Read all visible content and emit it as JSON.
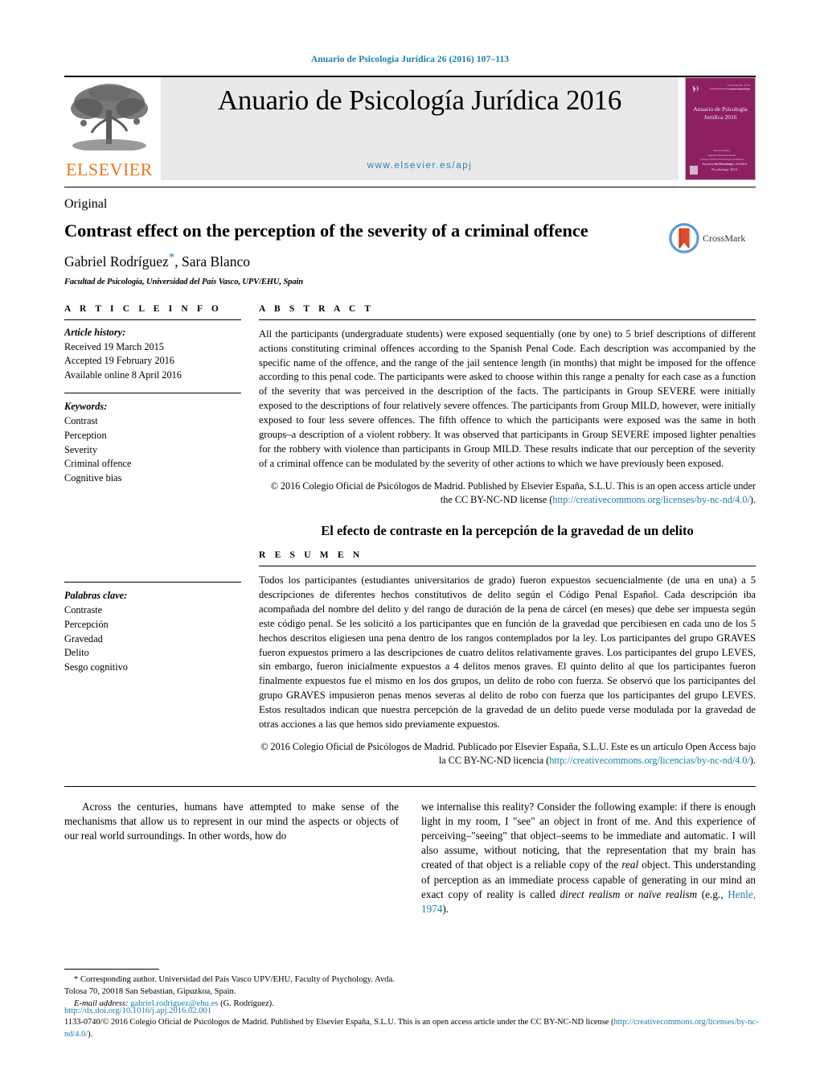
{
  "running_head": "Anuario de Psicología Jurídica 26 (2016) 107–113",
  "masthead": {
    "publisher_name": "ELSEVIER",
    "journal_title": "Anuario de Psicología Jurídica 2016",
    "journal_url": "www.elsevier.es/apj",
    "cover": {
      "issue_line1": "Volumen 26, 2016",
      "issue_line2": "ISSN 1133-0740",
      "title": "Anuario de Psicología Jurídica 2016",
      "mid_line1": "Director/Editor",
      "mid_line2": "Manuel Jiménez Redondo",
      "mid_line3": "Colegio Oficial de Psicólogos de Madrid",
      "mid_line4": "y Elsevier España",
      "bottom_line1": "Anuario de Psicología Jurídica",
      "bottom_line2": "Psychology 2016"
    }
  },
  "article": {
    "kind": "Original",
    "title": "Contrast effect on the perception of the severity of a criminal offence",
    "authors_part1": "Gabriel Rodríguez",
    "author_asterisk": "*",
    "authors_part2": ", Sara Blanco",
    "affiliation": "Facultad de Psicología, Universidad del País Vasco, UPV/EHU, Spain",
    "crossmark_label": "CrossMark"
  },
  "article_info": {
    "heading": "A R T I C L E   I N F O",
    "history_label": "Article history:",
    "received": "Received 19 March 2015",
    "accepted": "Accepted 19 February 2016",
    "available": "Available online 8 April 2016",
    "keywords_label": "Keywords:",
    "keywords": [
      "Contrast",
      "Perception",
      "Severity",
      "Criminal offence",
      "Cognitive bias"
    ],
    "palabras_label": "Palabras clave:",
    "palabras": [
      "Contraste",
      "Percepción",
      "Gravedad",
      "Delito",
      "Sesgo cognitivo"
    ]
  },
  "abstract": {
    "heading": "A B S T R A C T",
    "text": "All the participants (undergraduate students) were exposed sequentially (one by one) to 5 brief descriptions of different actions constituting criminal offences according to the Spanish Penal Code. Each description was accompanied by the specific name of the offence, and the range of the jail sentence length (in months) that might be imposed for the offence according to this penal code. The participants were asked to choose within this range a penalty for each case as a function of the severity that was perceived in the description of the facts. The participants in Group SEVERE were initially exposed to the descriptions of four relatively severe offences. The participants from Group MILD, however, were initially exposed to four less severe offences. The fifth offence to which the participants were exposed was the same in both groups–a description of a violent robbery. It was observed that participants in Group SEVERE imposed lighter penalties for the robbery with violence than participants in Group MILD. These results indicate that our perception of the severity of a criminal offence can be modulated by the severity of other actions to which we have previously been exposed.",
    "copyright_pre": "© 2016 Colegio Oficial de Psicólogos de Madrid. Published by Elsevier España, S.L.U. This is an open access article under the CC BY-NC-ND license (",
    "copyright_link": "http://creativecommons.org/licenses/by-nc-nd/4.0/",
    "copyright_post": ")."
  },
  "resumen": {
    "title_es": "El efecto de contraste en la percepción de la gravedad de un delito",
    "heading": "R E S U M E N",
    "text": "Todos los participantes (estudiantes universitarios de grado) fueron expuestos secuencialmente (de una en una) a 5 descripciones de diferentes hechos constitutivos de delito según el Código Penal Español. Cada descripción iba acompañada del nombre del delito y del rango de duración de la pena de cárcel (en meses) que debe ser impuesta según este código penal. Se les solicitó a los participantes que en función de la gravedad que percibiesen en cada uno de los 5 hechos descritos eligiesen una pena dentro de los rangos contemplados por la ley. Los participantes del grupo GRAVES fueron expuestos primero a las descripciones de cuatro delitos relativamente graves. Los participantes del grupo LEVES, sin embargo, fueron inicialmente expuestos a 4 delitos menos graves. El quinto delito al que los participantes fueron finalmente expuestos fue el mismo en los dos grupos, un delito de robo con fuerza. Se observó que los participantes del grupo GRAVES impusieron penas menos severas al delito de robo con fuerza que los participantes del grupo LEVES. Estos resultados indican que nuestra percepción de la gravedad de un delito puede verse modulada por la gravedad de otras acciones a las que hemos sido previamente expuestos.",
    "copyright_pre": "© 2016 Colegio Oficial de Psicólogos de Madrid. Publicado por Elsevier España, S.L.U. Este es un artículo Open Access bajo la CC BY-NC-ND licencia (",
    "copyright_link": "http://creativecommons.org/licencias/by-nc-nd/4.0/",
    "copyright_post": ")."
  },
  "body": {
    "left_col": "Across the centuries, humans have attempted to make sense of the mechanisms that allow us to represent in our mind the aspects or objects of our real world surroundings. In other words, how do",
    "right_col_pre": "we internalise this reality? Consider the following example: if there is enough light in my room, I \"see\" an object in front of me. And this experience of perceiving–\"seeing\" that object–seems to be immediate and automatic. I will also assume, without noticing, that the representation that my brain has created of that object is a reliable copy of the ",
    "right_col_italic1": "real",
    "right_col_mid": " object. This understanding of perception as an immediate process capable of generating in our mind an exact copy of reality is called ",
    "right_col_italic2": "direct realism",
    "right_col_mid2": " or ",
    "right_col_italic3": "naïve realism",
    "right_col_post": " (e.g., ",
    "right_col_citation": "Henle, 1974",
    "right_col_end": ")."
  },
  "footnote": {
    "marker": "*",
    "line1": " Corresponding author. Universidad del País Vasco UPV/EHU, Faculty of Psychology. Avda. Tolosa 70, 20018 San Sebastian, Gipuzkoa, Spain.",
    "email_label": "E-mail address:",
    "email": "gabriel.rodriguez@ehu.es",
    "email_attrib": " (G. Rodríguez)."
  },
  "footer": {
    "doi": "http://dx.doi.org/10.1016/j.apj.2016.02.001",
    "issn_copy_pre": "1133-0740/© 2016 Colegio Oficial de Psicólogos de Madrid. Published by Elsevier España, S.L.U. This is an open access article under the CC BY-NC-ND license (",
    "issn_copy_link": "http://creativecommons.org/licenses/by-nc-nd/4.0/",
    "issn_copy_post": ")."
  },
  "colors": {
    "link": "#1a7ea8",
    "elsevier_orange": "#E87722",
    "cover_purple": "#8e2062"
  }
}
